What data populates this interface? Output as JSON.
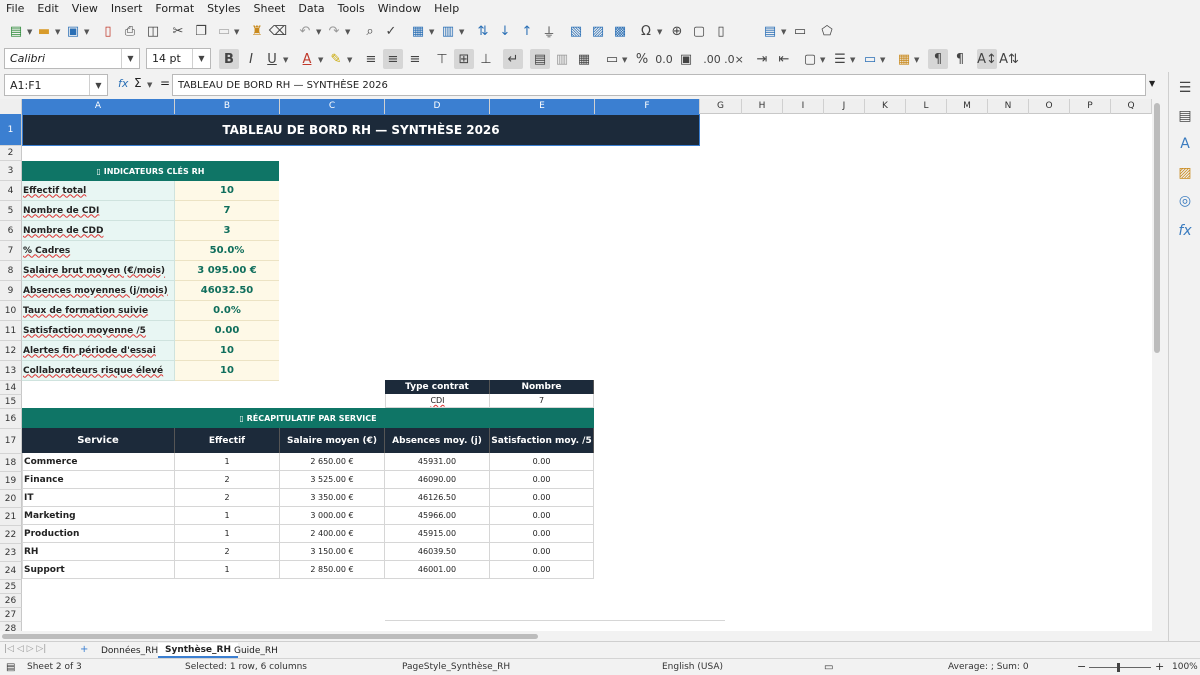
{
  "menu": [
    "File",
    "Edit",
    "View",
    "Insert",
    "Format",
    "Styles",
    "Sheet",
    "Data",
    "Tools",
    "Window",
    "Help"
  ],
  "toolbar2": {
    "font_name": "Calibri",
    "font_size": "14 pt",
    "bold": "B",
    "italic": "I",
    "underline": "U"
  },
  "formula_bar": {
    "name_box": "A1:F1",
    "fx": "fx",
    "sigma": "Σ",
    "equals": "=",
    "content": "TABLEAU DE BORD RH — SYNTHÈSE 2026"
  },
  "columns": [
    "A",
    "B",
    "C",
    "D",
    "E",
    "F",
    "G",
    "H",
    "I",
    "J",
    "K",
    "L",
    "M",
    "N",
    "O",
    "P",
    "Q"
  ],
  "rows": [
    "1",
    "2",
    "3",
    "4",
    "5",
    "6",
    "7",
    "8",
    "9",
    "10",
    "11",
    "12",
    "13",
    "14",
    "15",
    "16",
    "17",
    "18",
    "19",
    "20",
    "21",
    "22",
    "23",
    "24",
    "25",
    "26",
    "27",
    "28"
  ],
  "title": "TABLEAU DE BORD RH — SYNTHÈSE 2026",
  "kpi": {
    "header": "▯ INDICATEURS CLÉS RH",
    "items": [
      {
        "label": "Effectif total",
        "value": "10"
      },
      {
        "label": "Nombre de CDI",
        "value": "7"
      },
      {
        "label": "Nombre de CDD",
        "value": "3"
      },
      {
        "label": "% Cadres",
        "value": "50.0%"
      },
      {
        "label": "Salaire brut moyen (€/mois)",
        "value": "3 095.00 €"
      },
      {
        "label": "Absences moyennes (j/mois)",
        "value": "46032.50"
      },
      {
        "label": "Taux de formation suivie",
        "value": "0.0%"
      },
      {
        "label": "Satisfaction moyenne /5",
        "value": "0.00"
      },
      {
        "label": "Alertes fin période d'essai",
        "value": "10"
      },
      {
        "label": "Collaborateurs risque élevé",
        "value": "10"
      }
    ]
  },
  "contract": {
    "headers": [
      "Type contrat",
      "Nombre"
    ],
    "row": [
      "CDI",
      "7"
    ]
  },
  "recap": {
    "header": "▯ RÉCAPITULATIF PAR SERVICE",
    "columns": [
      "Service",
      "Effectif",
      "Salaire moyen (€)",
      "Absences moy. (j)",
      "Satisfaction moy. /5"
    ],
    "rows": [
      [
        "Commerce",
        "1",
        "2 650.00 €",
        "45931.00",
        "0.00"
      ],
      [
        "Finance",
        "2",
        "3 525.00 €",
        "46090.00",
        "0.00"
      ],
      [
        "IT",
        "2",
        "3 350.00 €",
        "46126.50",
        "0.00"
      ],
      [
        "Marketing",
        "1",
        "3 000.00 €",
        "45966.00",
        "0.00"
      ],
      [
        "Production",
        "1",
        "2 400.00 €",
        "45915.00",
        "0.00"
      ],
      [
        "RH",
        "2",
        "3 150.00 €",
        "46039.50",
        "0.00"
      ],
      [
        "Support",
        "1",
        "2 850.00 €",
        "46001.00",
        "0.00"
      ]
    ]
  },
  "sheets": [
    "Données_RH",
    "Synthèse_RH",
    "Guide_RH"
  ],
  "active_sheet": "Synthèse_RH",
  "status": {
    "sheet": "Sheet 2 of 3",
    "selection": "Selected: 1 row, 6 columns",
    "page_style": "PageStyle_Synthèse_RH",
    "language": "English (USA)",
    "summary": "Average: ; Sum: 0",
    "zoom": "100%"
  },
  "colors": {
    "title_bg": "#1c2a3a",
    "teal": "#0f7566",
    "selection": "#3b7fd1",
    "kpi_label_bg": "#e8f6f3",
    "kpi_value_bg": "#fef9e7"
  }
}
